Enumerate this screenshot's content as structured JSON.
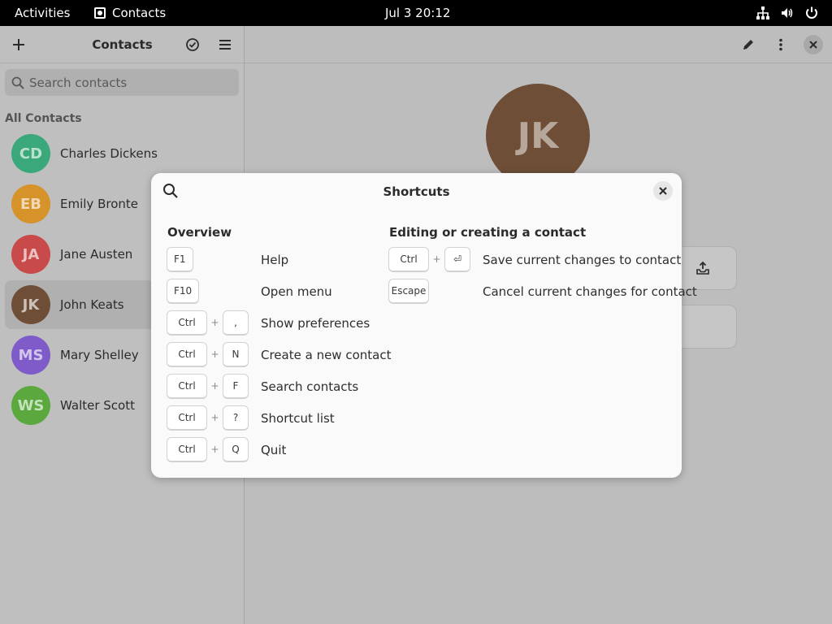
{
  "topbar": {
    "activities": "Activities",
    "app_name": "Contacts",
    "clock": "Jul 3  20:12",
    "tray_icons": [
      "network-icon",
      "volume-icon",
      "power-icon"
    ]
  },
  "sidebar": {
    "title": "Contacts",
    "search_placeholder": "Search contacts",
    "section": "All Contacts",
    "contacts": [
      {
        "initials": "CD",
        "name": "Charles Dickens",
        "color": "#3aa87a"
      },
      {
        "initials": "EB",
        "name": "Emily Bronte",
        "color": "#d5932a"
      },
      {
        "initials": "JA",
        "name": "Jane Austen",
        "color": "#c94a4a"
      },
      {
        "initials": "JK",
        "name": "John Keats",
        "color": "#6e4e37"
      },
      {
        "initials": "MS",
        "name": "Mary Shelley",
        "color": "#7e5bc8"
      },
      {
        "initials": "WS",
        "name": "Walter Scott",
        "color": "#5aa83e"
      }
    ]
  },
  "main": {
    "avatar_initials": "JK"
  },
  "dialog": {
    "title": "Shortcuts",
    "overview": {
      "title": "Overview",
      "items": [
        {
          "keys": [
            "F1"
          ],
          "desc": "Help"
        },
        {
          "keys": [
            "F10"
          ],
          "desc": "Open menu"
        },
        {
          "keys": [
            "Ctrl",
            ","
          ],
          "desc": "Show preferences"
        },
        {
          "keys": [
            "Ctrl",
            "N"
          ],
          "desc": "Create a new contact"
        },
        {
          "keys": [
            "Ctrl",
            "F"
          ],
          "desc": "Search contacts"
        },
        {
          "keys": [
            "Ctrl",
            "?"
          ],
          "desc": "Shortcut list"
        },
        {
          "keys": [
            "Ctrl",
            "Q"
          ],
          "desc": "Quit"
        }
      ]
    },
    "editing": {
      "title": "Editing or creating a contact",
      "items": [
        {
          "keys": [
            "Ctrl",
            "⏎"
          ],
          "desc": "Save current changes to contact"
        },
        {
          "keys": [
            "Escape"
          ],
          "desc": "Cancel current changes for contact"
        }
      ]
    },
    "plus": "+"
  },
  "colors": {
    "dialog_bg": "#fafafa",
    "dim_bg": "#bdbdbd"
  }
}
